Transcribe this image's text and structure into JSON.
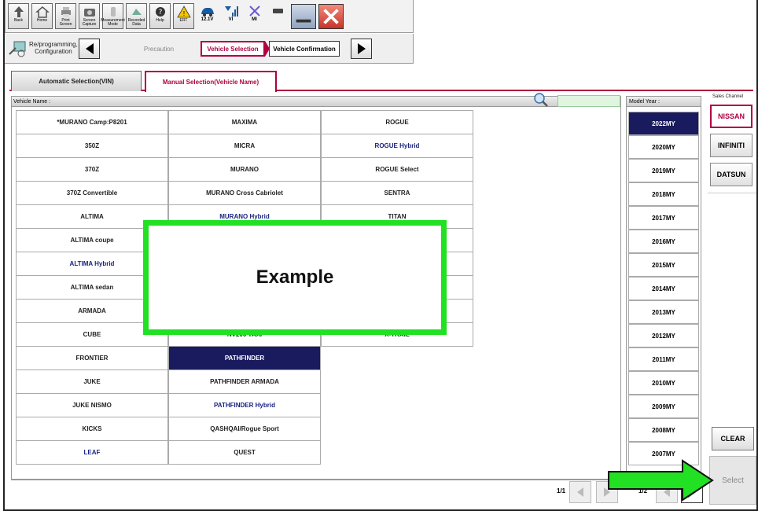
{
  "toolbar": {
    "buttons": [
      {
        "label": "Back",
        "icon": "back-arrow-icon"
      },
      {
        "label": "Home",
        "icon": "home-icon"
      },
      {
        "label": "Print Screen",
        "icon": "printer-icon"
      },
      {
        "label": "Screen\nCapture",
        "icon": "camera-icon"
      },
      {
        "label": "Measurement\nMode",
        "icon": "measurement-icon"
      },
      {
        "label": "Recorded\nData",
        "icon": "recorded-data-icon"
      },
      {
        "label": "Help",
        "icon": "help-icon"
      },
      {
        "label": "ERT",
        "icon": "warning-icon"
      }
    ],
    "status": [
      {
        "label": "12.1V",
        "icon": "car-battery-icon"
      },
      {
        "label": "VI",
        "icon": "signal-icon"
      },
      {
        "label": "MI",
        "icon": "mi-x-icon"
      }
    ]
  },
  "breadcrumb": {
    "section_label": "Re/programming,\nConfiguration",
    "steps": [
      "Precaution",
      "Vehicle Selection",
      "Vehicle Confirmation"
    ]
  },
  "tabs": {
    "automatic": "Automatic Selection(VIN)",
    "manual": "Manual Selection(Vehicle Name)"
  },
  "vehicle_name": {
    "header": "Vehicle Name :",
    "columns": [
      [
        "*MURANO Camp:P8201",
        "350Z",
        "370Z",
        "370Z Convertible",
        "ALTIMA",
        "ALTIMA coupe",
        "ALTIMA Hybrid",
        "ALTIMA sedan",
        "ARMADA",
        "CUBE",
        "FRONTIER",
        "JUKE",
        "JUKE NISMO",
        "KICKS",
        "LEAF"
      ],
      [
        "MAXIMA",
        "MICRA",
        "MURANO",
        "MURANO Cross Cabriolet",
        "MURANO Hybrid",
        "",
        "",
        "",
        "",
        "NV200 TAXI",
        "PATHFINDER",
        "PATHFINDER ARMADA",
        "PATHFINDER Hybrid",
        "QASHQAI/Rogue Sport",
        "QUEST"
      ],
      [
        "ROGUE",
        "ROGUE Hybrid",
        "ROGUE Select",
        "SENTRA",
        "TITAN",
        "",
        "",
        "",
        "",
        "X-TRAIL"
      ]
    ],
    "page": "1/1"
  },
  "model_year": {
    "header": "Model Year :",
    "years": [
      "2022MY",
      "2020MY",
      "2019MY",
      "2018MY",
      "2017MY",
      "2016MY",
      "2015MY",
      "2014MY",
      "2013MY",
      "2012MY",
      "2011MY",
      "2010MY",
      "2009MY",
      "2008MY",
      "2007MY"
    ],
    "page": "1/2"
  },
  "sales_channel": {
    "header": "Sales Channel",
    "options": [
      "NISSAN",
      "INFINITI",
      "DATSUN"
    ]
  },
  "buttons": {
    "clear": "CLEAR",
    "select": "Select"
  },
  "overlay": {
    "text": "Example"
  },
  "colors": {
    "accent": "#b00040",
    "selected": "#1a1a5e",
    "highlight_green": "#22e022"
  }
}
